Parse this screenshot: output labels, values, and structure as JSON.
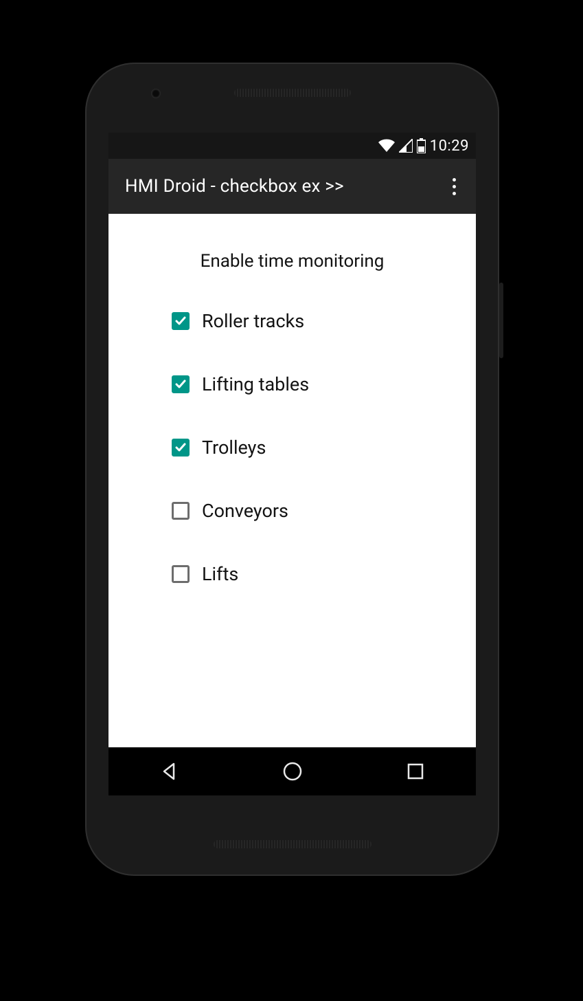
{
  "status": {
    "time": "10:29"
  },
  "appbar": {
    "title": "HMI Droid - checkbox ex >>"
  },
  "content": {
    "heading": "Enable time monitoring",
    "items": [
      {
        "label": "Roller tracks",
        "checked": true
      },
      {
        "label": "Lifting tables",
        "checked": true
      },
      {
        "label": "Trolleys",
        "checked": true
      },
      {
        "label": "Conveyors",
        "checked": false
      },
      {
        "label": "Lifts",
        "checked": false
      }
    ]
  },
  "colors": {
    "accent": "#009688"
  }
}
